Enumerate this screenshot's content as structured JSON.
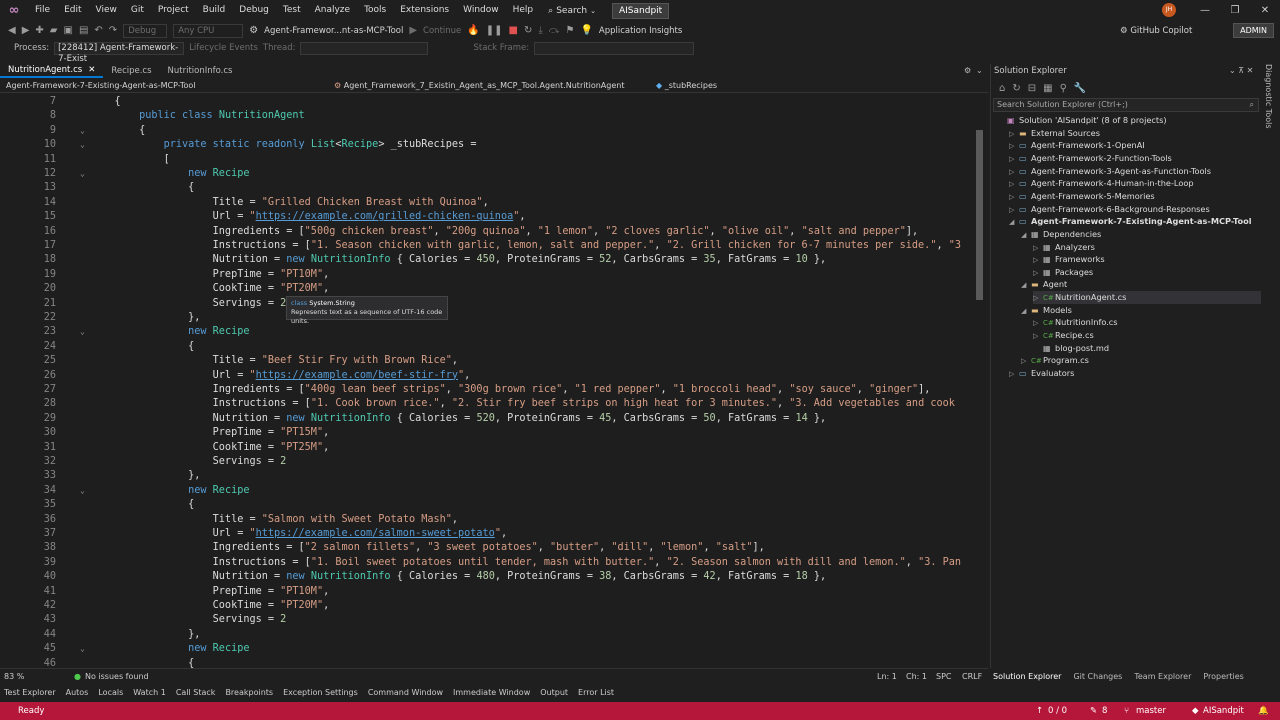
{
  "menubar": {
    "items": [
      "File",
      "Edit",
      "View",
      "Git",
      "Project",
      "Build",
      "Debug",
      "Test",
      "Analyze",
      "Tools",
      "Extensions",
      "Window",
      "Help"
    ],
    "search_label": "Search",
    "solution_name": "AISandpit",
    "avatar_initials": "JH"
  },
  "toolbar": {
    "config": "Debug",
    "platform": "Any CPU",
    "startup_project": "Agent-Framewor...nt-as-MCP-Tool",
    "continue_label": "Continue",
    "app_insights": "Application Insights",
    "copilot": "GitHub Copilot",
    "admin": "ADMIN"
  },
  "processbar": {
    "process_label": "Process:",
    "process_value": "[228412] Agent-Framework-7-Exist",
    "lifecycle": "Lifecycle Events",
    "thread_label": "Thread:",
    "stackframe_label": "Stack Frame:"
  },
  "tabs": [
    "NutritionAgent.cs",
    "Recipe.cs",
    "NutritionInfo.cs"
  ],
  "navbar": {
    "project": "Agent-Framework-7-Existing-Agent-as-MCP-Tool",
    "class": "Agent_Framework_7_Existin_Agent_as_MCP_Tool.Agent.NutritionAgent",
    "member": "_stubRecipes"
  },
  "tooltip": {
    "line1_kw": "class",
    "line1_type": "System.String",
    "line2": "Represents text as a sequence of UTF-16 code units."
  },
  "code_lines": [
    {
      "n": "7",
      "fold": "",
      "parts": [
        [
          "pr",
          "    {"
        ]
      ]
    },
    {
      "n": "8",
      "fold": "",
      "parts": [
        [
          "kw",
          "        public class "
        ],
        [
          "ty",
          "NutritionAgent"
        ]
      ]
    },
    {
      "n": "9",
      "fold": "⌄",
      "parts": [
        [
          "pr",
          "        {"
        ]
      ]
    },
    {
      "n": "10",
      "fold": "⌄",
      "parts": [
        [
          "kw",
          "            private static readonly "
        ],
        [
          "ty",
          "List"
        ],
        [
          "pr",
          "<"
        ],
        [
          "ty",
          "Recipe"
        ],
        [
          "pr",
          "> _stubRecipes ="
        ]
      ]
    },
    {
      "n": "11",
      "fold": "",
      "parts": [
        [
          "pr",
          "            ["
        ]
      ]
    },
    {
      "n": "12",
      "fold": "⌄",
      "parts": [
        [
          "kw",
          "                new "
        ],
        [
          "ty",
          "Recipe"
        ]
      ]
    },
    {
      "n": "13",
      "fold": "",
      "parts": [
        [
          "pr",
          "                {"
        ]
      ]
    },
    {
      "n": "14",
      "fold": "",
      "parts": [
        [
          "pr",
          "                    Title = "
        ],
        [
          "st",
          "\"Grilled Chicken Breast with Quinoa\""
        ],
        [
          "pr",
          ","
        ]
      ]
    },
    {
      "n": "15",
      "fold": "",
      "parts": [
        [
          "pr",
          "                    Url = "
        ],
        [
          "st",
          "\""
        ],
        [
          "lk",
          "https://example.com/grilled-chicken-quinoa"
        ],
        [
          "st",
          "\""
        ],
        [
          "pr",
          ","
        ]
      ]
    },
    {
      "n": "16",
      "fold": "",
      "parts": [
        [
          "pr",
          "                    Ingredients = ["
        ],
        [
          "st",
          "\"500g chicken breast\""
        ],
        [
          "pr",
          ", "
        ],
        [
          "st",
          "\"200g quinoa\""
        ],
        [
          "pr",
          ", "
        ],
        [
          "st",
          "\"1 lemon\""
        ],
        [
          "pr",
          ", "
        ],
        [
          "st",
          "\"2 cloves garlic\""
        ],
        [
          "pr",
          ", "
        ],
        [
          "st",
          "\"olive oil\""
        ],
        [
          "pr",
          ", "
        ],
        [
          "st",
          "\"salt and pepper\""
        ],
        [
          "pr",
          "],"
        ]
      ]
    },
    {
      "n": "17",
      "fold": "",
      "parts": [
        [
          "pr",
          "                    Instructions = ["
        ],
        [
          "st",
          "\"1. Season chicken with garlic, lemon, salt and pepper.\""
        ],
        [
          "pr",
          ", "
        ],
        [
          "st",
          "\"2. Grill chicken for 6-7 minutes per side.\""
        ],
        [
          "pr",
          ", "
        ],
        [
          "st",
          "\"3"
        ]
      ]
    },
    {
      "n": "18",
      "fold": "",
      "parts": [
        [
          "pr",
          "                    Nutrition = "
        ],
        [
          "kw",
          "new "
        ],
        [
          "ty",
          "NutritionInfo"
        ],
        [
          "pr",
          " { Calories = "
        ],
        [
          "nm",
          "450"
        ],
        [
          "pr",
          ", ProteinGrams = "
        ],
        [
          "nm",
          "52"
        ],
        [
          "pr",
          ", CarbsGrams = "
        ],
        [
          "nm",
          "35"
        ],
        [
          "pr",
          ", FatGrams = "
        ],
        [
          "nm",
          "10"
        ],
        [
          "pr",
          " },"
        ]
      ]
    },
    {
      "n": "19",
      "fold": "",
      "parts": [
        [
          "pr",
          "                    PrepTime = "
        ],
        [
          "st",
          "\"PT10M\""
        ],
        [
          "pr",
          ","
        ]
      ]
    },
    {
      "n": "20",
      "fold": "",
      "parts": [
        [
          "pr",
          "                    CookTime = "
        ],
        [
          "st",
          "\"PT20M\""
        ],
        [
          "pr",
          ","
        ]
      ]
    },
    {
      "n": "21",
      "fold": "",
      "parts": [
        [
          "pr",
          "                    Servings = "
        ],
        [
          "nm",
          "2"
        ]
      ]
    },
    {
      "n": "22",
      "fold": "",
      "parts": [
        [
          "pr",
          "                },"
        ]
      ]
    },
    {
      "n": "23",
      "fold": "⌄",
      "parts": [
        [
          "kw",
          "                new "
        ],
        [
          "ty",
          "Recipe"
        ]
      ]
    },
    {
      "n": "24",
      "fold": "",
      "parts": [
        [
          "pr",
          "                {"
        ]
      ]
    },
    {
      "n": "25",
      "fold": "",
      "parts": [
        [
          "pr",
          "                    Title = "
        ],
        [
          "st",
          "\"Beef Stir Fry with Brown Rice\""
        ],
        [
          "pr",
          ","
        ]
      ]
    },
    {
      "n": "26",
      "fold": "",
      "parts": [
        [
          "pr",
          "                    Url = "
        ],
        [
          "st",
          "\""
        ],
        [
          "lk",
          "https://example.com/beef-stir-fry"
        ],
        [
          "st",
          "\""
        ],
        [
          "pr",
          ","
        ]
      ]
    },
    {
      "n": "27",
      "fold": "",
      "parts": [
        [
          "pr",
          "                    Ingredients = ["
        ],
        [
          "st",
          "\"400g lean beef strips\""
        ],
        [
          "pr",
          ", "
        ],
        [
          "st",
          "\"300g brown rice\""
        ],
        [
          "pr",
          ", "
        ],
        [
          "st",
          "\"1 red pepper\""
        ],
        [
          "pr",
          ", "
        ],
        [
          "st",
          "\"1 broccoli head\""
        ],
        [
          "pr",
          ", "
        ],
        [
          "st",
          "\"soy sauce\""
        ],
        [
          "pr",
          ", "
        ],
        [
          "st",
          "\"ginger\""
        ],
        [
          "pr",
          "],"
        ]
      ]
    },
    {
      "n": "28",
      "fold": "",
      "parts": [
        [
          "pr",
          "                    Instructions = ["
        ],
        [
          "st",
          "\"1. Cook brown rice.\""
        ],
        [
          "pr",
          ", "
        ],
        [
          "st",
          "\"2. Stir fry beef strips on high heat for 3 minutes.\""
        ],
        [
          "pr",
          ", "
        ],
        [
          "st",
          "\"3. Add vegetables and cook"
        ]
      ]
    },
    {
      "n": "29",
      "fold": "",
      "parts": [
        [
          "pr",
          "                    Nutrition = "
        ],
        [
          "kw",
          "new "
        ],
        [
          "ty",
          "NutritionInfo"
        ],
        [
          "pr",
          " { Calories = "
        ],
        [
          "nm",
          "520"
        ],
        [
          "pr",
          ", ProteinGrams = "
        ],
        [
          "nm",
          "45"
        ],
        [
          "pr",
          ", CarbsGrams = "
        ],
        [
          "nm",
          "50"
        ],
        [
          "pr",
          ", FatGrams = "
        ],
        [
          "nm",
          "14"
        ],
        [
          "pr",
          " },"
        ]
      ]
    },
    {
      "n": "30",
      "fold": "",
      "parts": [
        [
          "pr",
          "                    PrepTime = "
        ],
        [
          "st",
          "\"PT15M\""
        ],
        [
          "pr",
          ","
        ]
      ]
    },
    {
      "n": "31",
      "fold": "",
      "parts": [
        [
          "pr",
          "                    CookTime = "
        ],
        [
          "st",
          "\"PT25M\""
        ],
        [
          "pr",
          ","
        ]
      ]
    },
    {
      "n": "32",
      "fold": "",
      "parts": [
        [
          "pr",
          "                    Servings = "
        ],
        [
          "nm",
          "2"
        ]
      ]
    },
    {
      "n": "33",
      "fold": "",
      "parts": [
        [
          "pr",
          "                },"
        ]
      ]
    },
    {
      "n": "34",
      "fold": "⌄",
      "parts": [
        [
          "kw",
          "                new "
        ],
        [
          "ty",
          "Recipe"
        ]
      ]
    },
    {
      "n": "35",
      "fold": "",
      "parts": [
        [
          "pr",
          "                {"
        ]
      ]
    },
    {
      "n": "36",
      "fold": "",
      "parts": [
        [
          "pr",
          "                    Title = "
        ],
        [
          "st",
          "\"Salmon with Sweet Potato Mash\""
        ],
        [
          "pr",
          ","
        ]
      ]
    },
    {
      "n": "37",
      "fold": "",
      "parts": [
        [
          "pr",
          "                    Url = "
        ],
        [
          "st",
          "\""
        ],
        [
          "lk",
          "https://example.com/salmon-sweet-potato"
        ],
        [
          "st",
          "\""
        ],
        [
          "pr",
          ","
        ]
      ]
    },
    {
      "n": "38",
      "fold": "",
      "parts": [
        [
          "pr",
          "                    Ingredients = ["
        ],
        [
          "st",
          "\"2 salmon fillets\""
        ],
        [
          "pr",
          ", "
        ],
        [
          "st",
          "\"3 sweet potatoes\""
        ],
        [
          "pr",
          ", "
        ],
        [
          "st",
          "\"butter\""
        ],
        [
          "pr",
          ", "
        ],
        [
          "st",
          "\"dill\""
        ],
        [
          "pr",
          ", "
        ],
        [
          "st",
          "\"lemon\""
        ],
        [
          "pr",
          ", "
        ],
        [
          "st",
          "\"salt\""
        ],
        [
          "pr",
          "],"
        ]
      ]
    },
    {
      "n": "39",
      "fold": "",
      "parts": [
        [
          "pr",
          "                    Instructions = ["
        ],
        [
          "st",
          "\"1. Boil sweet potatoes until tender, mash with butter.\""
        ],
        [
          "pr",
          ", "
        ],
        [
          "st",
          "\"2. Season salmon with dill and lemon.\""
        ],
        [
          "pr",
          ", "
        ],
        [
          "st",
          "\"3. Pan"
        ]
      ]
    },
    {
      "n": "40",
      "fold": "",
      "parts": [
        [
          "pr",
          "                    Nutrition = "
        ],
        [
          "kw",
          "new "
        ],
        [
          "ty",
          "NutritionInfo"
        ],
        [
          "pr",
          " { Calories = "
        ],
        [
          "nm",
          "480"
        ],
        [
          "pr",
          ", ProteinGrams = "
        ],
        [
          "nm",
          "38"
        ],
        [
          "pr",
          ", CarbsGrams = "
        ],
        [
          "nm",
          "42"
        ],
        [
          "pr",
          ", FatGrams = "
        ],
        [
          "nm",
          "18"
        ],
        [
          "pr",
          " },"
        ]
      ]
    },
    {
      "n": "41",
      "fold": "",
      "parts": [
        [
          "pr",
          "                    PrepTime = "
        ],
        [
          "st",
          "\"PT10M\""
        ],
        [
          "pr",
          ","
        ]
      ]
    },
    {
      "n": "42",
      "fold": "",
      "parts": [
        [
          "pr",
          "                    CookTime = "
        ],
        [
          "st",
          "\"PT20M\""
        ],
        [
          "pr",
          ","
        ]
      ]
    },
    {
      "n": "43",
      "fold": "",
      "parts": [
        [
          "pr",
          "                    Servings = "
        ],
        [
          "nm",
          "2"
        ]
      ]
    },
    {
      "n": "44",
      "fold": "",
      "parts": [
        [
          "pr",
          "                },"
        ]
      ]
    },
    {
      "n": "45",
      "fold": "⌄",
      "parts": [
        [
          "kw",
          "                new "
        ],
        [
          "ty",
          "Recipe"
        ]
      ]
    },
    {
      "n": "46",
      "fold": "",
      "parts": [
        [
          "pr",
          "                {"
        ]
      ]
    }
  ],
  "editor_status": {
    "zoom": "83 %",
    "issues": "No issues found",
    "line": "Ln: 1",
    "col": "Ch: 1",
    "spc": "SPC",
    "crlf": "CRLF"
  },
  "solution_explorer": {
    "title": "Solution Explorer",
    "search_placeholder": "Search Solution Explorer (Ctrl+;)",
    "nodes": [
      {
        "label": "Solution 'AISandpit' (8 of 8 projects)",
        "icon": "sol",
        "depth": 0,
        "tw": ""
      },
      {
        "label": "External Sources",
        "icon": "folder",
        "depth": 1,
        "tw": "▷"
      },
      {
        "label": "Agent-Framework-1-OpenAI",
        "icon": "proj",
        "depth": 1,
        "tw": "▷"
      },
      {
        "label": "Agent-Framework-2-Function-Tools",
        "icon": "proj",
        "depth": 1,
        "tw": "▷"
      },
      {
        "label": "Agent-Framework-3-Agent-as-Function-Tools",
        "icon": "proj",
        "depth": 1,
        "tw": "▷"
      },
      {
        "label": "Agent-Framework-4-Human-in-the-Loop",
        "icon": "proj",
        "depth": 1,
        "tw": "▷"
      },
      {
        "label": "Agent-Framework-5-Memories",
        "icon": "proj",
        "depth": 1,
        "tw": "▷"
      },
      {
        "label": "Agent-Framework-6-Background-Responses",
        "icon": "proj",
        "depth": 1,
        "tw": "▷"
      },
      {
        "label": "Agent-Framework-7-Existing-Agent-as-MCP-Tool",
        "icon": "proj",
        "depth": 1,
        "tw": "◢",
        "bold": true
      },
      {
        "label": "Dependencies",
        "icon": "gen",
        "depth": 2,
        "tw": "◢"
      },
      {
        "label": "Analyzers",
        "icon": "gen",
        "depth": 3,
        "tw": "▷"
      },
      {
        "label": "Frameworks",
        "icon": "gen",
        "depth": 3,
        "tw": "▷"
      },
      {
        "label": "Packages",
        "icon": "gen",
        "depth": 3,
        "tw": "▷"
      },
      {
        "label": "Agent",
        "icon": "folder",
        "depth": 2,
        "tw": "◢"
      },
      {
        "label": "NutritionAgent.cs",
        "icon": "cs",
        "depth": 3,
        "tw": "▷",
        "sel": true
      },
      {
        "label": "Models",
        "icon": "folder",
        "depth": 2,
        "tw": "◢"
      },
      {
        "label": "NutritionInfo.cs",
        "icon": "cs",
        "depth": 3,
        "tw": "▷"
      },
      {
        "label": "Recipe.cs",
        "icon": "cs",
        "depth": 3,
        "tw": "▷"
      },
      {
        "label": "blog-post.md",
        "icon": "gen",
        "depth": 3,
        "tw": ""
      },
      {
        "label": "Program.cs",
        "icon": "cs",
        "depth": 2,
        "tw": "▷"
      },
      {
        "label": "Evaluators",
        "icon": "proj",
        "depth": 1,
        "tw": "▷"
      }
    ],
    "bottom_tabs": [
      "Solution Explorer",
      "Git Changes",
      "Team Explorer",
      "Properties"
    ]
  },
  "diagnostic_tools": "Diagnostic Tools",
  "bottom_tabs": [
    "Test Explorer",
    "Autos",
    "Locals",
    "Watch 1",
    "Call Stack",
    "Breakpoints",
    "Exception Settings",
    "Command Window",
    "Immediate Window",
    "Output",
    "Error List"
  ],
  "statusbar": {
    "ready": "Ready",
    "errors": "0 / 0",
    "changes": "8",
    "branch": "master",
    "repo": "AISandpit",
    "color": "#b5173a"
  }
}
